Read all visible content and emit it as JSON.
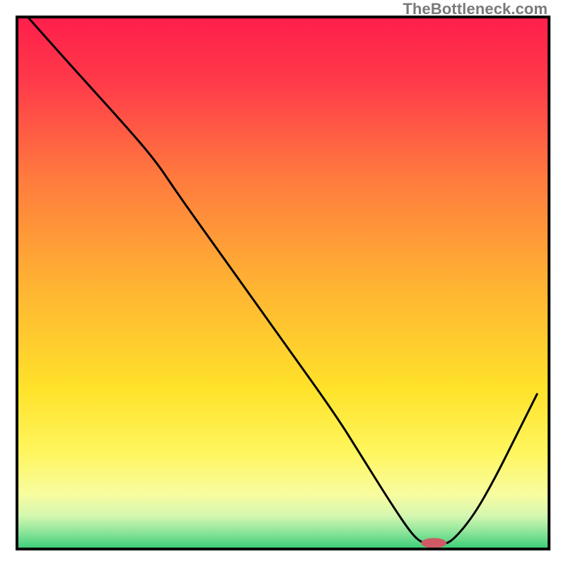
{
  "watermark": "TheBottleneck.com",
  "chart_data": {
    "type": "line",
    "title": "",
    "xlabel": "",
    "ylabel": "",
    "xlim": [
      0,
      100
    ],
    "ylim": [
      0,
      100
    ],
    "grid": false,
    "legend": false,
    "curve_x": [
      2,
      10,
      20,
      26,
      30,
      40,
      50,
      60,
      65,
      70,
      74,
      76,
      78,
      80,
      82,
      86,
      90,
      94,
      98
    ],
    "curve_y": [
      100,
      91,
      80,
      73,
      67,
      53,
      39,
      25,
      17,
      9,
      3,
      1,
      0.6,
      0.6,
      1.2,
      6,
      13,
      21,
      29
    ],
    "marker": {
      "x": 78.5,
      "y": 0.6,
      "color": "#cf5a66",
      "rx": 18,
      "ry": 7
    },
    "gradient_stops": [
      {
        "offset": 0.0,
        "color": "#ff1f4b"
      },
      {
        "offset": 0.12,
        "color": "#ff3a4a"
      },
      {
        "offset": 0.3,
        "color": "#ff7a3e"
      },
      {
        "offset": 0.5,
        "color": "#ffb233"
      },
      {
        "offset": 0.7,
        "color": "#ffe22a"
      },
      {
        "offset": 0.82,
        "color": "#fff65e"
      },
      {
        "offset": 0.9,
        "color": "#f7fca0"
      },
      {
        "offset": 0.94,
        "color": "#d4f7b0"
      },
      {
        "offset": 0.97,
        "color": "#8ee59a"
      },
      {
        "offset": 1.0,
        "color": "#3fcf7a"
      }
    ]
  }
}
